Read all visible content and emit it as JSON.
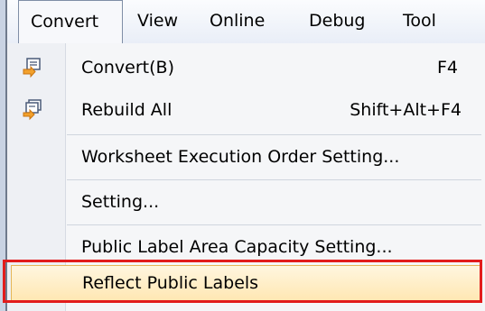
{
  "menubar": {
    "items": [
      {
        "label": "Convert"
      },
      {
        "label": "View"
      },
      {
        "label": "Online"
      },
      {
        "label": "Debug"
      },
      {
        "label": "Tool"
      }
    ]
  },
  "menu": {
    "items": [
      {
        "label": "Convert(B)",
        "shortcut": "F4",
        "icon": "convert-icon"
      },
      {
        "label": "Rebuild All",
        "shortcut": "Shift+Alt+F4",
        "icon": "rebuild-all-icon"
      },
      {
        "label": "Worksheet Execution Order Setting..."
      },
      {
        "label": "Setting..."
      },
      {
        "label": "Public Label Area Capacity Setting..."
      },
      {
        "label": "Reflect Public Labels"
      }
    ]
  },
  "colors": {
    "highlight_border": "#e21c1c",
    "hover_fill": "#ffe7b3"
  }
}
